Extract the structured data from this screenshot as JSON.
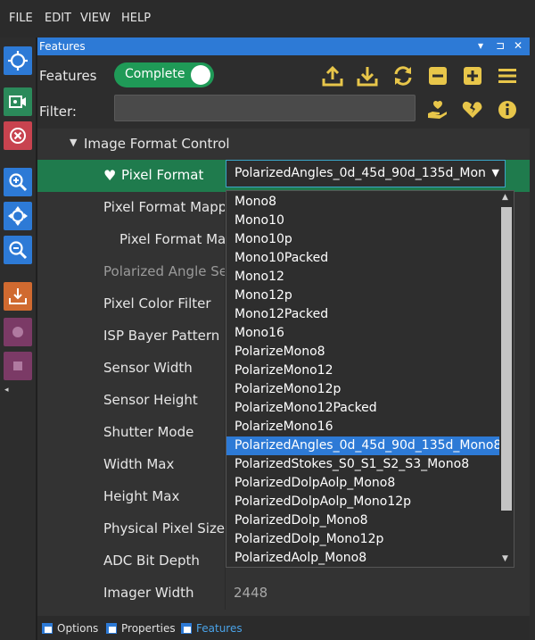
{
  "menu": [
    "FILE",
    "EDIT",
    "VIEW",
    "HELP"
  ],
  "panel": {
    "title": "Features",
    "controls": [
      "▾",
      "⊐",
      "✕"
    ]
  },
  "features": {
    "label": "Features",
    "status": "Complete"
  },
  "filter": {
    "label": "Filter:",
    "value": "",
    "placeholder": ""
  },
  "tree": {
    "group": "Image Format Control",
    "rows": [
      {
        "label": "Pixel Format",
        "value": ""
      },
      {
        "label": "Pixel Format Mapping",
        "value": ""
      },
      {
        "label": "Pixel Format Mapping",
        "value": ""
      },
      {
        "label": "Polarized Angle Selector",
        "value": ""
      },
      {
        "label": "Pixel Color Filter",
        "value": ""
      },
      {
        "label": "ISP Bayer Pattern",
        "value": ""
      },
      {
        "label": "Sensor Width",
        "value": ""
      },
      {
        "label": "Sensor Height",
        "value": ""
      },
      {
        "label": "Shutter Mode",
        "value": ""
      },
      {
        "label": "Width Max",
        "value": ""
      },
      {
        "label": "Height Max",
        "value": ""
      },
      {
        "label": "Physical Pixel Size",
        "value": ""
      },
      {
        "label": "ADC Bit Depth",
        "value": ""
      },
      {
        "label": "Imager Width",
        "value": "2448"
      }
    ]
  },
  "pixel_format": {
    "selected": "PolarizedAngles_0d_45d_90d_135d_Mono8",
    "selected_display": "PolarizedAngles_0d_45d_90d_135d_Mon",
    "options": [
      "Mono8",
      "Mono10",
      "Mono10p",
      "Mono10Packed",
      "Mono12",
      "Mono12p",
      "Mono12Packed",
      "Mono16",
      "PolarizeMono8",
      "PolarizeMono12",
      "PolarizeMono12p",
      "PolarizeMono12Packed",
      "PolarizeMono16",
      "PolarizedAngles_0d_45d_90d_135d_Mono8",
      "PolarizedStokes_S0_S1_S2_S3_Mono8",
      "PolarizedDolpAolp_Mono8",
      "PolarizedDolpAolp_Mono12p",
      "PolarizedDolp_Mono8",
      "PolarizedDolp_Mono12p",
      "PolarizedAolp_Mono8"
    ]
  },
  "tabs": [
    "Options",
    "Properties",
    "Features"
  ],
  "colors": {
    "accent": "#2d7ad6",
    "toggle_on": "#1f9a57",
    "selected_row": "#1f7b4d",
    "icon_yellow": "#e8c64a"
  }
}
